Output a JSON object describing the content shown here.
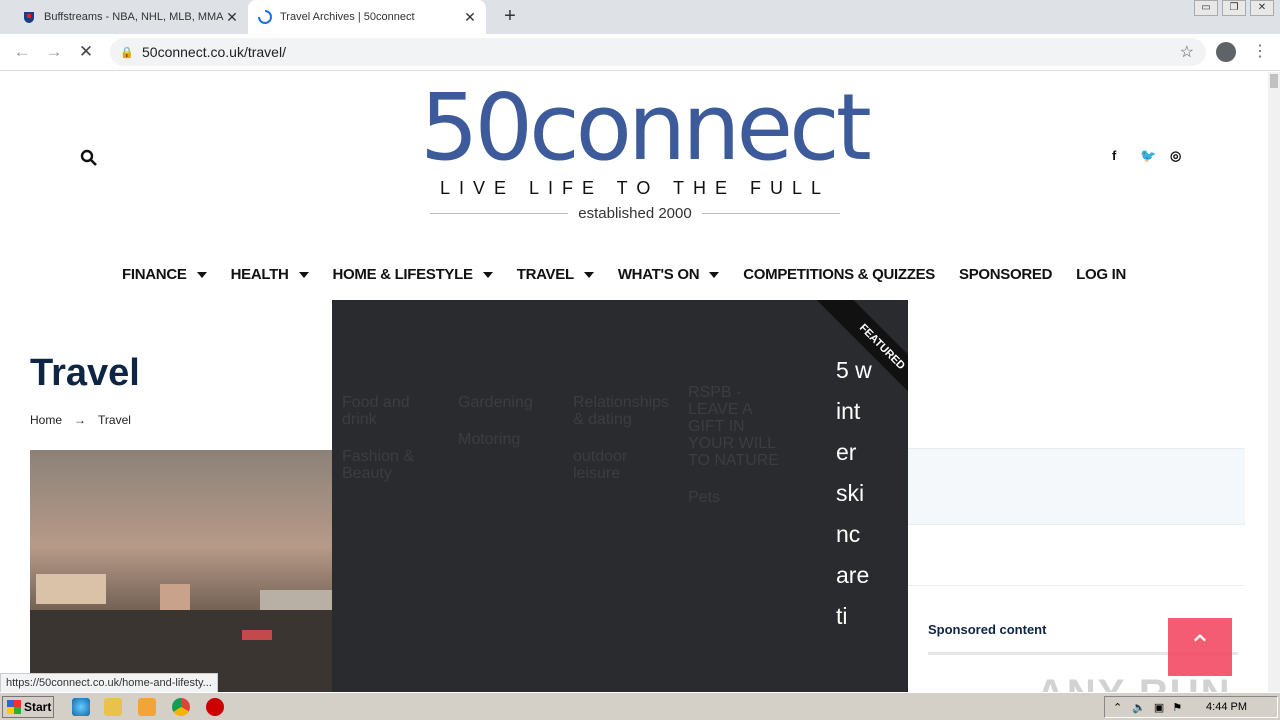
{
  "browser": {
    "tabs": [
      {
        "title": "Buffstreams - NBA, NHL, MLB, MMA,",
        "active": false
      },
      {
        "title": "Travel Archives | 50connect",
        "active": true
      }
    ],
    "url": "50connect.co.uk/travel/",
    "status_url": "https://50connect.co.uk/home-and-lifesty..."
  },
  "site": {
    "logo_word": "50connect",
    "tagline": "LIVE LIFE TO THE FULL",
    "established": "established 2000",
    "brand_color": "#3d5a9a"
  },
  "social": [
    "f",
    "🐦",
    "◎"
  ],
  "nav": [
    {
      "label": "FINANCE",
      "has_menu": true
    },
    {
      "label": "HEALTH",
      "has_menu": true
    },
    {
      "label": "HOME & LIFESTYLE",
      "has_menu": true
    },
    {
      "label": "TRAVEL",
      "has_menu": true
    },
    {
      "label": "WHAT'S ON",
      "has_menu": true
    },
    {
      "label": "COMPETITIONS & QUIZZES",
      "has_menu": false
    },
    {
      "label": "SPONSORED",
      "has_menu": false
    },
    {
      "label": "LOG IN",
      "has_menu": false
    }
  ],
  "page": {
    "title": "Travel",
    "breadcrumb": [
      "Home",
      "Travel"
    ],
    "breadcrumb_sep": "→",
    "sponsored_label": "Sponsored content"
  },
  "dropdown": {
    "links": [
      "Food and drink",
      "Fashion & Beauty",
      "Gardening",
      "Motoring",
      "Relationships & dating",
      "outdoor leisure",
      "RSPB - LEAVE A GIFT IN YOUR WILL TO NATURE",
      "Pets"
    ],
    "featured_badge": "FEATURED",
    "featured_title": "5 winter skincare ti"
  },
  "taskbar": {
    "start_label": "Start",
    "clock": "4:44 PM"
  },
  "watermark": "ANY RUN"
}
